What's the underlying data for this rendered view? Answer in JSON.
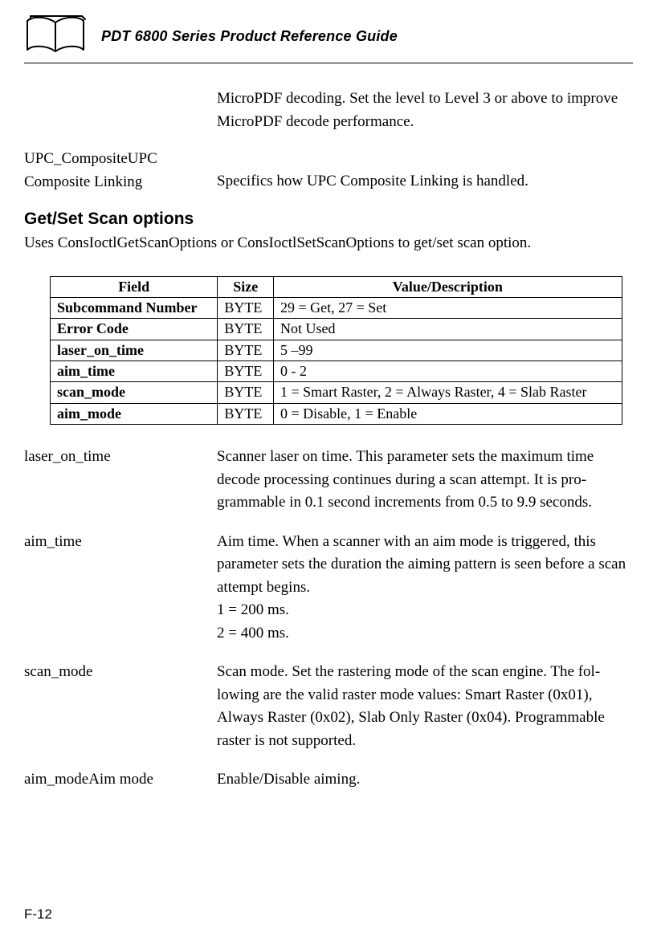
{
  "header": {
    "title": "PDT 6800 Series Product Reference Guide"
  },
  "intro_block": "MicroPDF decoding.  Set the level to Level 3 or above to improve MicroPDF decode performance.",
  "upc": {
    "term_line1": "UPC_CompositeUPC",
    "term_line2": "Composite Linking",
    "desc": "Specifics how UPC Composite Linking is handled."
  },
  "section": {
    "heading": "Get/Set Scan options",
    "intro": "Uses ConsIoctlGetScanOptions or ConsIoctlSetScanOptions to get/set scan option."
  },
  "table": {
    "headers": {
      "c0": "Field",
      "c1": "Size",
      "c2": "Value/Description"
    },
    "rows": [
      {
        "field": "Subcommand Number",
        "size": "BYTE",
        "value": "29 = Get, 27 = Set"
      },
      {
        "field": "Error Code",
        "size": "BYTE",
        "value": "Not Used"
      },
      {
        "field": "laser_on_time",
        "size": "BYTE",
        "value": "5 –99"
      },
      {
        "field": "aim_time",
        "size": "BYTE",
        "value": "0 - 2"
      },
      {
        "field": "scan_mode",
        "size": "BYTE",
        "value": "1 = Smart Raster, 2 = Always Raster, 4 = Slab Raster"
      },
      {
        "field": "aim_mode",
        "size": "BYTE",
        "value": "0 = Disable, 1 = Enable"
      }
    ]
  },
  "defs": [
    {
      "term": "laser_on_time",
      "desc": "Scanner laser on time.  This parameter sets the maximum time decode processing continues during a scan attempt. It is pro­grammable in 0.1 second increments from 0.5 to 9.9 seconds."
    },
    {
      "term": "aim_time",
      "desc": "Aim time.  When a scanner with an aim mode is triggered, this parameter sets the duration the aiming pattern is seen before a scan attempt begins.\n1 = 200 ms.\n2 = 400 ms."
    },
    {
      "term": "scan_mode",
      "desc": "Scan mode.  Set the rastering mode of the scan engine.  The fol­lowing are the valid raster mode values: Smart Raster (0x01), Always Raster (0x02), Slab Only Raster (0x04).  Programmable raster is not supported."
    },
    {
      "term": "aim_modeAim mode",
      "desc": "Enable/Disable aiming."
    }
  ],
  "page_number": "F-12"
}
